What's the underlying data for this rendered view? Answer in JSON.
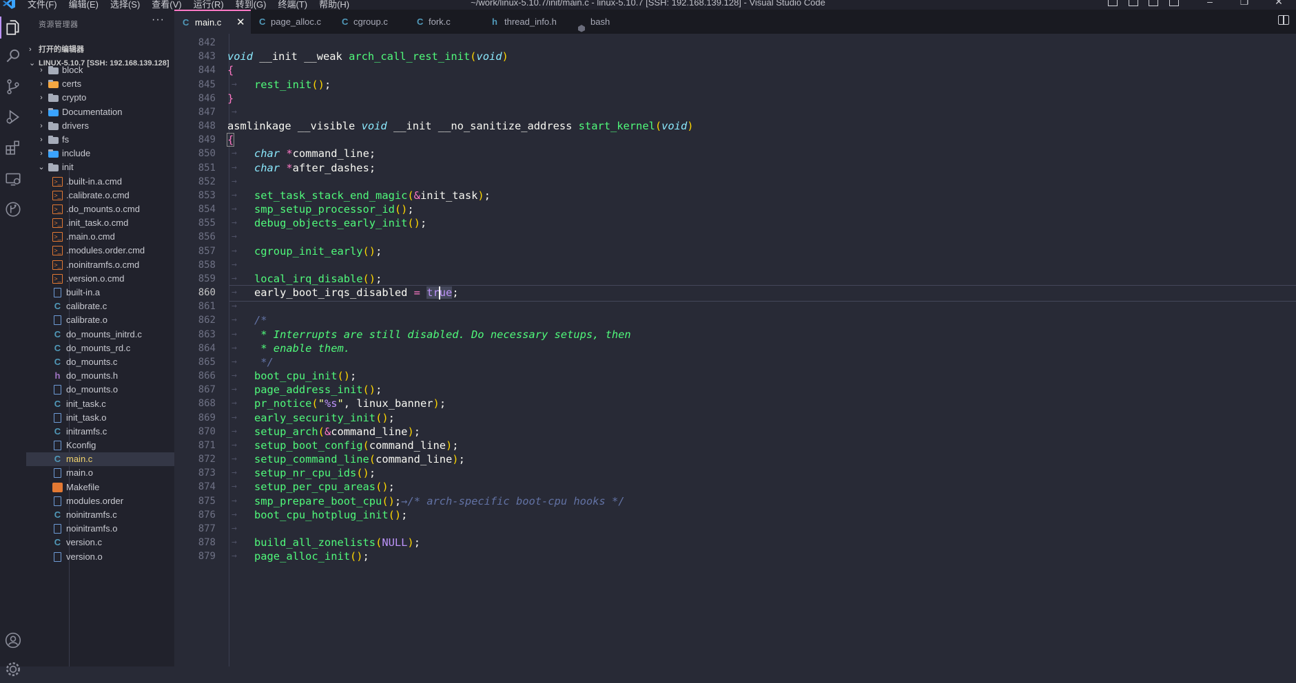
{
  "window": {
    "title": "~/work/linux-5.10.7/init/main.c - linux-5.10.7 [SSH: 192.168.139.128] - Visual Studio Code",
    "menus": [
      "文件(F)",
      "编辑(E)",
      "选择(S)",
      "查看(V)",
      "运行(R)",
      "转到(G)",
      "终端(T)",
      "帮助(H)"
    ]
  },
  "activity_bar": {
    "items": [
      "explorer-icon",
      "search-icon",
      "source-control-icon",
      "run-debug-icon",
      "extensions-icon",
      "remote-explorer-icon",
      "git-graph-icon"
    ],
    "bottom": [
      "account-icon",
      "manage-gear-icon"
    ]
  },
  "sidebar": {
    "header": "资源管理器",
    "more": "···",
    "open_editors": "打开的编辑器",
    "workspace": "LINUX-5.10.7 [SSH: 192.168.139.128]",
    "items": [
      {
        "label": "block",
        "kind": "folder",
        "depth": 0,
        "expanded": false
      },
      {
        "label": "certs",
        "kind": "folder",
        "depth": 0,
        "expanded": false,
        "icon_color": "#f4a742"
      },
      {
        "label": "crypto",
        "kind": "folder",
        "depth": 0,
        "expanded": false
      },
      {
        "label": "Documentation",
        "kind": "folder",
        "depth": 0,
        "expanded": false,
        "icon_color": "#3aa3ff"
      },
      {
        "label": "drivers",
        "kind": "folder",
        "depth": 0,
        "expanded": false
      },
      {
        "label": "fs",
        "kind": "folder",
        "depth": 0,
        "expanded": false
      },
      {
        "label": "include",
        "kind": "folder",
        "depth": 0,
        "expanded": false,
        "icon_color": "#3aa3ff"
      },
      {
        "label": "init",
        "kind": "folder-open",
        "depth": 0,
        "expanded": true
      },
      {
        "label": ".built-in.a.cmd",
        "kind": "cmd",
        "depth": 1
      },
      {
        "label": ".calibrate.o.cmd",
        "kind": "cmd",
        "depth": 1
      },
      {
        "label": ".do_mounts.o.cmd",
        "kind": "cmd",
        "depth": 1
      },
      {
        "label": ".init_task.o.cmd",
        "kind": "cmd",
        "depth": 1
      },
      {
        "label": ".main.o.cmd",
        "kind": "cmd",
        "depth": 1
      },
      {
        "label": ".modules.order.cmd",
        "kind": "cmd",
        "depth": 1
      },
      {
        "label": ".noinitramfs.o.cmd",
        "kind": "cmd",
        "depth": 1
      },
      {
        "label": ".version.o.cmd",
        "kind": "cmd",
        "depth": 1
      },
      {
        "label": "built-in.a",
        "kind": "file",
        "depth": 1
      },
      {
        "label": "calibrate.c",
        "kind": "c",
        "depth": 1
      },
      {
        "label": "calibrate.o",
        "kind": "file",
        "depth": 1
      },
      {
        "label": "do_mounts_initrd.c",
        "kind": "c",
        "depth": 1
      },
      {
        "label": "do_mounts_rd.c",
        "kind": "c",
        "depth": 1
      },
      {
        "label": "do_mounts.c",
        "kind": "c",
        "depth": 1
      },
      {
        "label": "do_mounts.h",
        "kind": "h",
        "depth": 1
      },
      {
        "label": "do_mounts.o",
        "kind": "file",
        "depth": 1
      },
      {
        "label": "init_task.c",
        "kind": "c",
        "depth": 1
      },
      {
        "label": "init_task.o",
        "kind": "file",
        "depth": 1
      },
      {
        "label": "initramfs.c",
        "kind": "c",
        "depth": 1
      },
      {
        "label": "Kconfig",
        "kind": "file",
        "depth": 1
      },
      {
        "label": "main.c",
        "kind": "c",
        "depth": 1,
        "selected": true
      },
      {
        "label": "main.o",
        "kind": "file",
        "depth": 1
      },
      {
        "label": "Makefile",
        "kind": "make",
        "depth": 1
      },
      {
        "label": "modules.order",
        "kind": "file",
        "depth": 1
      },
      {
        "label": "noinitramfs.c",
        "kind": "c",
        "depth": 1
      },
      {
        "label": "noinitramfs.o",
        "kind": "file",
        "depth": 1
      },
      {
        "label": "version.c",
        "kind": "c",
        "depth": 1
      },
      {
        "label": "version.o",
        "kind": "file",
        "depth": 1
      }
    ]
  },
  "tabs": [
    {
      "label": "main.c",
      "icon": "C",
      "active": true,
      "close": "✕"
    },
    {
      "label": "page_alloc.c",
      "icon": "C"
    },
    {
      "label": "cgroup.c",
      "icon": "C"
    },
    {
      "label": "fork.c",
      "icon": "C"
    },
    {
      "label": "thread_info.h",
      "icon": "h"
    },
    {
      "label": "bash",
      "icon": "terminal-icon"
    }
  ],
  "editor": {
    "current_line": 860,
    "line_numbers": [
      "842",
      "843",
      "844",
      "845",
      "846",
      "847",
      "848",
      "849",
      "850",
      "851",
      "852",
      "853",
      "854",
      "855",
      "856",
      "857",
      "858",
      "859",
      "860",
      "861",
      "862",
      "863",
      "864",
      "865",
      "866",
      "867",
      "868",
      "869",
      "870",
      "871",
      "872",
      "873",
      "874",
      "875",
      "876",
      "877",
      "878",
      "879"
    ],
    "colors": {
      "function": "#50fa7b",
      "keyword": "#8be9fd",
      "operator": "#ff79c6",
      "comment": "#6272a4",
      "background": "#282a36"
    }
  }
}
